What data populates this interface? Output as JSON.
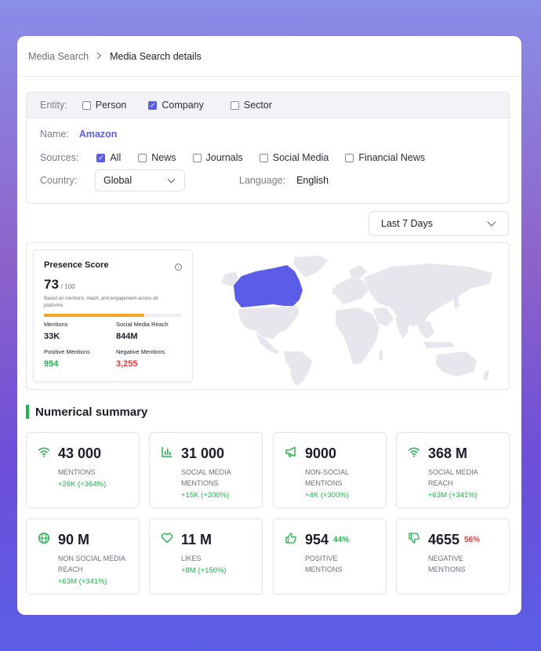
{
  "breadcrumb": {
    "parent": "Media Search",
    "separator": ">",
    "current": "Media Search details"
  },
  "filters": {
    "entity_label": "Entity:",
    "entities": [
      {
        "label": "Person",
        "checked": false
      },
      {
        "label": "Company",
        "checked": true
      },
      {
        "label": "Sector",
        "checked": false
      }
    ],
    "name_label": "Name:",
    "name_value": "Amazon",
    "sources_label": "Sources:",
    "sources": [
      {
        "label": "All",
        "checked": true
      },
      {
        "label": "News",
        "checked": false
      },
      {
        "label": "Journals",
        "checked": false
      },
      {
        "label": "Social Media",
        "checked": false
      },
      {
        "label": "Financial News",
        "checked": false
      }
    ],
    "country_label": "Country:",
    "country_value": "Global",
    "language_label": "Language:",
    "language_value": "English"
  },
  "period": {
    "value": "Last 7 Days"
  },
  "presence": {
    "title": "Presence Score",
    "score": "73",
    "max": "/ 100",
    "progress": 0.73,
    "description": "Based on mentions, reach, and engagement across all platforms",
    "mentions_label": "Mentions",
    "mentions_value": "33K",
    "reach_label": "Social Media Reach",
    "reach_value": "844M",
    "positive_label": "Positive Mentions",
    "positive_value": "954",
    "negative_label": "Negative Mentions",
    "negative_value": "3,255",
    "highlight_color": "#5b5ce8",
    "highlighted_region": "Canada"
  },
  "summary": {
    "title": "Numerical summary",
    "cards": [
      {
        "icon": "wifi-icon",
        "value": "43 000",
        "caption1": "MENTIONS",
        "caption2": "",
        "delta": "+26K (+364%)"
      },
      {
        "icon": "bar-chart-icon",
        "value": "31 000",
        "caption1": "SOCIAL MEDIA",
        "caption2": "MENTIONS",
        "delta": "+15K (+200%)"
      },
      {
        "icon": "megaphone-icon",
        "value": "9000",
        "caption1": "NON-SOCIAL",
        "caption2": "MENTIONS",
        "delta": "+4K (+300%)"
      },
      {
        "icon": "wifi-icon",
        "value": "368 M",
        "caption1": "SOCIAL MEDIA",
        "caption2": "REACH",
        "delta": "+63M (+341%)"
      },
      {
        "icon": "globe-icon",
        "value": "90 M",
        "caption1": "NON SOCIAL MEDIA",
        "caption2": "REACH",
        "delta": "+63M (+341%)"
      },
      {
        "icon": "heart-icon",
        "value": "11 M",
        "caption1": "LIKES",
        "caption2": "",
        "delta": "+8M (+150%)"
      },
      {
        "icon": "thumbs-up-icon",
        "value": "954",
        "pct": "44%",
        "caption1": "POSITIVE",
        "caption2": "MENTIONS",
        "delta": ""
      },
      {
        "icon": "thumbs-down-icon",
        "value": "4655",
        "pct": "56%",
        "caption1": "NEGATIVE",
        "caption2": "MENTIONS",
        "delta": ""
      }
    ]
  },
  "colors": {
    "accent": "#5b5ce8",
    "positive": "#22b24c",
    "negative": "#e23b3b",
    "progress": "#f2a623"
  }
}
